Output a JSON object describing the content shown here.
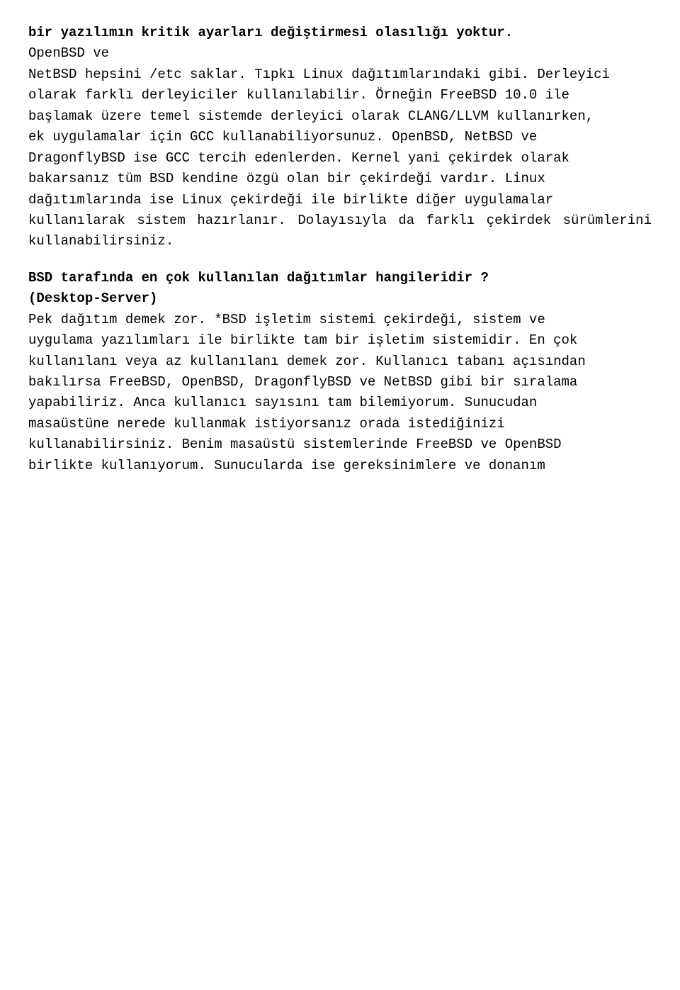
{
  "para1_line1_bold": "bir yazılımın kritik ayarları değiştirmesi olasılığı yoktur.",
  "para1_line2": "OpenBSD ve",
  "para1_line3": "NetBSD hepsini /etc saklar. Tıpkı Linux dağıtımlarındaki gibi. Derleyici",
  "para1_line4": "olarak farklı derleyiciler kullanılabilir. Örneğin FreeBSD 10.0 ile",
  "para1_line5": "başlamak üzere temel sistemde derleyici olarak CLANG/LLVM kullanırken,",
  "para1_line6": "ek uygulamalar için GCC kullanabiliyorsunuz. OpenBSD, NetBSD ve",
  "para1_line7": "DragonflyBSD ise GCC tercih edenlerden. Kernel yani çekirdek olarak",
  "para1_line8": "bakarsanız tüm BSD kendine özgü olan bir çekirdeği vardır. Linux",
  "para1_line9": "dağıtımlarında ise Linux çekirdeği ile birlikte diğer uygulamalar",
  "para1_line10": "kullanılarak sistem hazırlanır. Dolayısıyla da farklı çekirdek sürümlerini kullanabilirsiniz.",
  "heading_line1": "BSD tarafında en çok kullanılan dağıtımlar hangileridir ?",
  "heading_line2": "(Desktop-Server)",
  "para2_line1": "Pek dağıtım demek zor. *BSD işletim sistemi çekirdeği, sistem ve",
  "para2_line2": "uygulama yazılımları ile birlikte tam bir işletim sistemidir. En çok",
  "para2_line3": "kullanılanı veya az kullanılanı demek zor. Kullanıcı tabanı açısından",
  "para2_line4": "bakılırsa FreeBSD, OpenBSD, DragonflyBSD ve NetBSD gibi bir sıralama",
  "para2_line5": "yapabiliriz. Anca kullanıcı sayısını tam bilemiyorum. Sunucudan",
  "para2_line6": "masaüstüne nerede kullanmak istiyorsanız orada istediğinizi",
  "para2_line7": "kullanabilirsiniz. Benim masaüstü sistemlerinde FreeBSD ve OpenBSD",
  "para2_line8": "birlikte kullanıyorum. Sunucularda ise gereksinimlere ve donanım"
}
